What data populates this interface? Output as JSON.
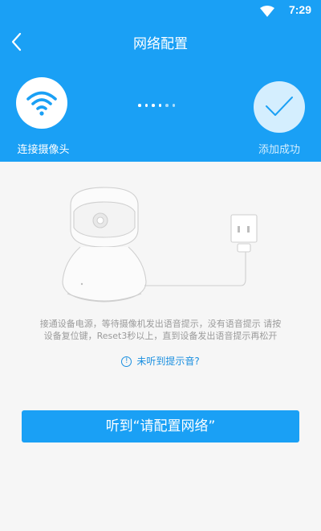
{
  "status_bar": {
    "time": "7:29",
    "wifi_icon": "wifi-full-icon",
    "battery_icon": "battery-icon"
  },
  "header": {
    "title": "网络配置",
    "back_icon": "chevron-left-icon"
  },
  "steps": {
    "left": {
      "label": "连接摄像头",
      "icon": "wifi-icon"
    },
    "right": {
      "label": "添加成功",
      "icon": "checkmark-icon"
    },
    "progress_dots_total": 6,
    "progress_dots_active": 4
  },
  "instruction": {
    "line1": "接通设备电源，等待摄像机发出语音提示，没有语音提示 请按",
    "line2": "设备复位键，Reset3秒以上，直到设备发出语音提示再松开"
  },
  "hint_link": {
    "label": "未听到提示音?",
    "icon": "info-icon"
  },
  "primary_button": {
    "label": "听到“请配置网络”"
  },
  "colors": {
    "brand": "#1aa0f5",
    "link": "#1a8fe0",
    "background": "#f6f6f6"
  }
}
